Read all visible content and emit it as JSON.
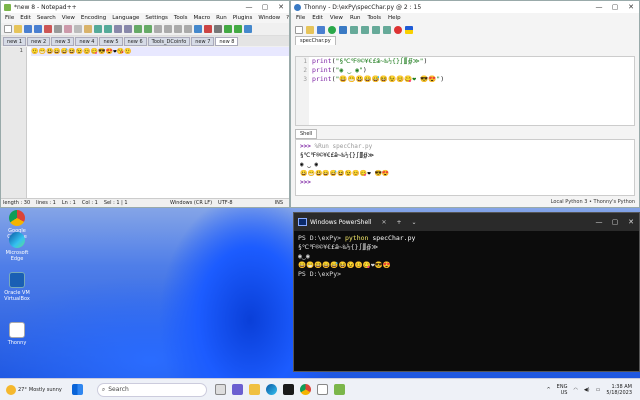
{
  "desktop": {
    "icons": [
      {
        "label": "Google Chrome"
      },
      {
        "label": "Microsoft Edge"
      },
      {
        "label": "Oracle VM VirtualBox"
      },
      {
        "label": "Thonny"
      }
    ]
  },
  "notepadpp": {
    "title": "*new 8 - Notepad++",
    "menu": [
      "File",
      "Edit",
      "Search",
      "View",
      "Encoding",
      "Language",
      "Settings",
      "Tools",
      "Macro",
      "Run",
      "Plugins",
      "Window",
      "?"
    ],
    "tabs": [
      "new 1",
      "new 2",
      "new 3",
      "new 4",
      "new 5",
      "new 6",
      "Tools_DCoinfo",
      "new 7",
      "new 8"
    ],
    "line_number": "1",
    "content": "🙂😁😃😄😅😆😉😊😋😎😍❤😘🙂",
    "status": {
      "length": "length : 30",
      "lines": "lines : 1",
      "ln": "Ln : 1",
      "col": "Col : 1",
      "sel": "Sel : 1 | 1",
      "eol": "Windows (CR LF)",
      "encoding": "UTF-8",
      "mode": "INS"
    }
  },
  "thonny": {
    "title": "Thonny - D:\\exPy\\specChar.py @ 2 : 15",
    "menu": [
      "File",
      "Edit",
      "View",
      "Run",
      "Tools",
      "Help"
    ],
    "file_tab": "specChar.py",
    "line_numbers": [
      "1",
      "2",
      "3"
    ],
    "code_lines": [
      {
        "kw": "print",
        "str": "\"§℃℉®©¥€£ǣ~‰½{}∫∭∯≫\"",
        "rest": ")"
      },
      {
        "kw": "print",
        "str": "\"◉ ‿ ◉\"",
        "rest": ")"
      },
      {
        "kw": "print",
        "str": "\"😀😁😃😄😅😆😉😊😋❤  😎😍\"",
        "rest": ")"
      }
    ],
    "shell_tab": "Shell",
    "shell_prompt": ">>>",
    "shell_cmd": "%Run specChar.py",
    "shell_out": [
      "§℃℉®©¥€£ǣ~‰½{}∫∭∯≫",
      "◉ ‿ ◉",
      "😀😁😃😄😅😆😉😊😋❤  😎😍"
    ],
    "status": "Local Python 3 • Thonny's Python"
  },
  "powershell": {
    "title": "Windows PowerShell",
    "prompt": "PS D:\\exPy>",
    "command": "python",
    "command_arg": "specChar.py",
    "output": [
      "§℃℉®©¥€£ǣ~‰½{}∫∭∯≫",
      "◉‿◉",
      "😀😁😃😄😅😆😉😊😋❤😎😍"
    ],
    "prompt2": "PS D:\\exPy>"
  },
  "taskbar": {
    "weather_temp": "27°",
    "weather_desc": "Mostly sunny",
    "search_placeholder": "Search",
    "lang_top": "ENG",
    "lang_bottom": "US",
    "time": "1:38 AM",
    "date": "5/18/2023"
  }
}
